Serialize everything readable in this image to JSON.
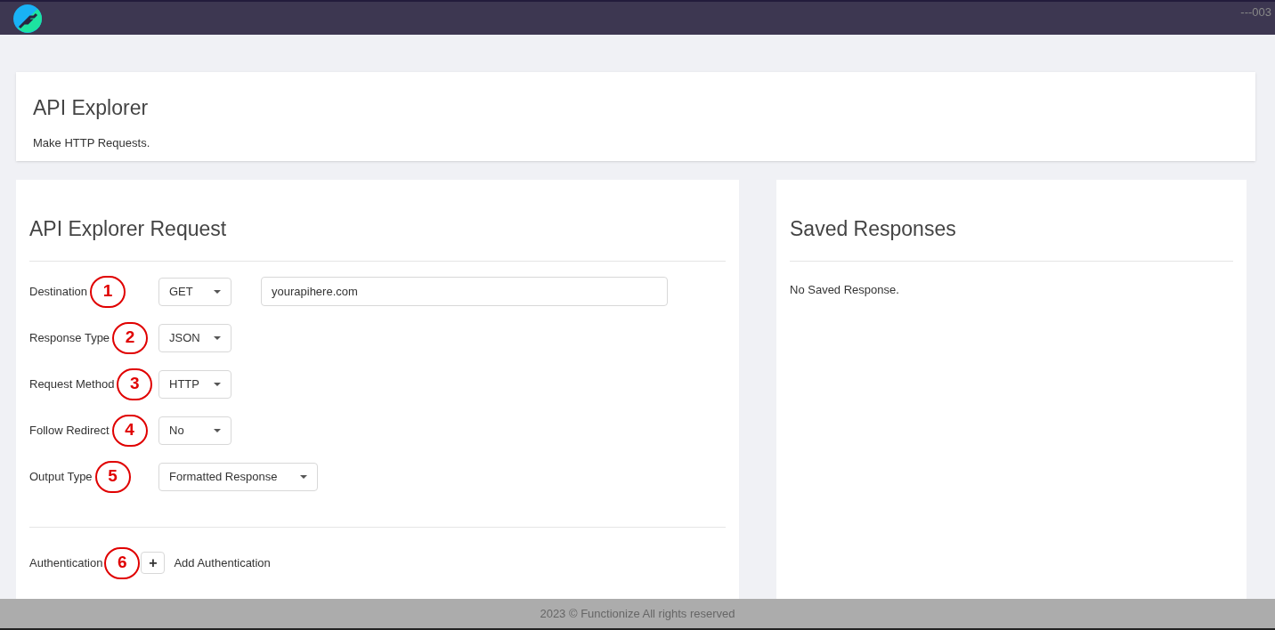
{
  "top_bar": {
    "code": "---003"
  },
  "header": {
    "title": "API Explorer",
    "subtitle": "Make HTTP Requests."
  },
  "request": {
    "title": "API Explorer Request",
    "fields": [
      {
        "label": "Destination",
        "marker": "1",
        "value": "GET",
        "url": "yourapihere.com"
      },
      {
        "label": "Response Type",
        "marker": "2",
        "value": "JSON"
      },
      {
        "label": "Request Method",
        "marker": "3",
        "value": "HTTP"
      },
      {
        "label": "Follow Redirect",
        "marker": "4",
        "value": "No"
      },
      {
        "label": "Output Type",
        "marker": "5",
        "value": "Formatted Response"
      }
    ],
    "authentication": {
      "label": "Authentication",
      "marker": "6",
      "button": "+",
      "action": "Add Authentication"
    }
  },
  "saved": {
    "title": "Saved Responses",
    "empty": "No Saved Response."
  },
  "footer": "2023 © Functionize All rights reserved"
}
